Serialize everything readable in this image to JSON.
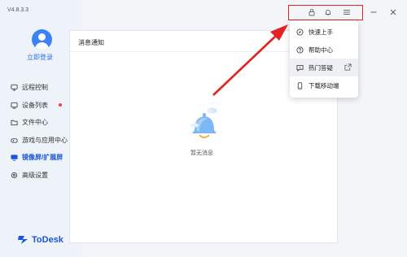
{
  "app": {
    "version": "V4.8.3.3",
    "brand_name": "ToDesk",
    "accent": "#1a56db"
  },
  "sidebar": {
    "login_label": "立即登录",
    "items": [
      {
        "label": "远程控制",
        "icon": "remote-control-icon"
      },
      {
        "label": "设备列表",
        "icon": "device-list-icon",
        "badge": "red-dot"
      },
      {
        "label": "文件中心",
        "icon": "folder-icon"
      },
      {
        "label": "游戏与应用中心",
        "icon": "game-icon"
      },
      {
        "label": "镜像屏/扩展屏",
        "icon": "mirror-screen-icon",
        "active": true
      },
      {
        "label": "高级设置",
        "icon": "gear-icon"
      }
    ]
  },
  "panel": {
    "title": "消息通知",
    "empty_text": "暂无消息"
  },
  "dropdown": {
    "items": [
      {
        "label": "快速上手",
        "icon": "compass-icon"
      },
      {
        "label": "帮助中心",
        "icon": "help-icon"
      },
      {
        "label": "热门答疑",
        "icon": "qa-icon",
        "external": true
      },
      {
        "label": "下载移动端",
        "icon": "mobile-icon"
      }
    ]
  },
  "titlebar": {
    "icons": [
      "lock-icon",
      "bell-icon",
      "menu-icon",
      "minimize-icon",
      "close-icon"
    ]
  },
  "annotation": {
    "color": "#e02424"
  }
}
